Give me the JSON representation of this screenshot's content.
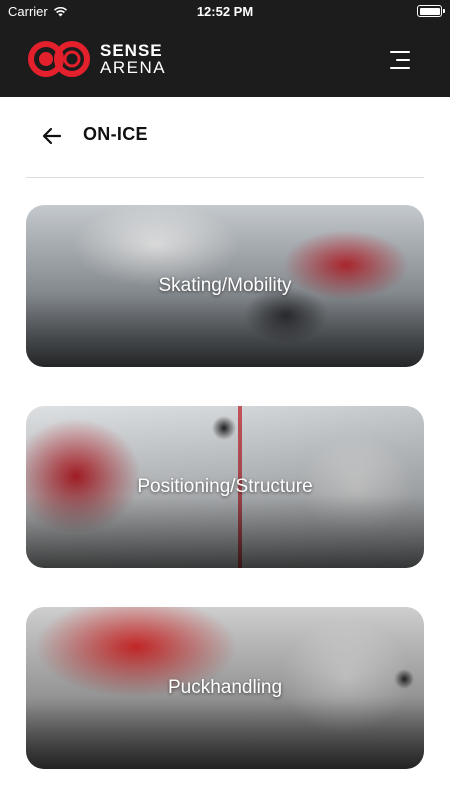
{
  "status_bar": {
    "carrier": "Carrier",
    "time": "12:52 PM"
  },
  "header": {
    "logo_line1": "SENSE",
    "logo_line2": "ARENA",
    "accent_color": "#e3202b"
  },
  "page": {
    "title": "ON-ICE"
  },
  "cards": [
    {
      "label": "Skating/Mobility"
    },
    {
      "label": "Positioning/Structure"
    },
    {
      "label": "Puckhandling"
    }
  ]
}
